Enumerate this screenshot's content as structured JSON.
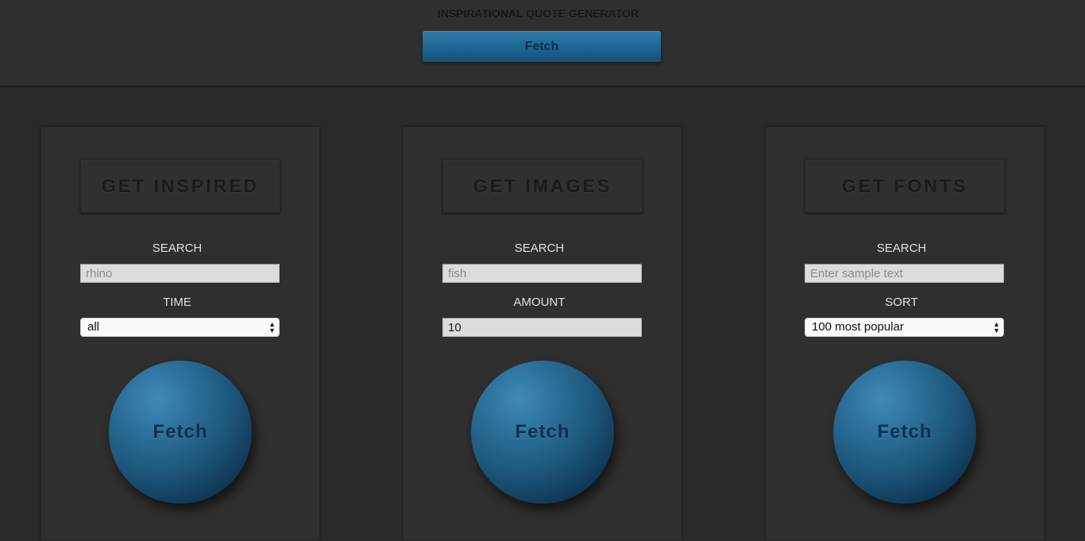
{
  "header": {
    "title": "INSPIRATIONAL QUOTE GENERATOR",
    "fetch_label": "Fetch"
  },
  "cards": [
    {
      "heading": "GET INSPIRED",
      "field1_label": "SEARCH",
      "field1_value": "rhino",
      "field2_label": "TIME",
      "field2_value": "all",
      "button_label": "Fetch"
    },
    {
      "heading": "GET IMAGES",
      "field1_label": "SEARCH",
      "field1_value": "fish",
      "field2_label": "AMOUNT",
      "field2_value": "10",
      "button_label": "Fetch"
    },
    {
      "heading": "GET FONTS",
      "field1_label": "SEARCH",
      "field1_placeholder": "Enter sample text",
      "field2_label": "SORT",
      "field2_value": "100 most popular",
      "button_label": "Fetch"
    }
  ],
  "icons": {
    "select_arrows": "▲▼"
  },
  "colors": {
    "accent": "#1d6592",
    "background": "#2a2a2a",
    "panel": "#2f2f2f"
  }
}
